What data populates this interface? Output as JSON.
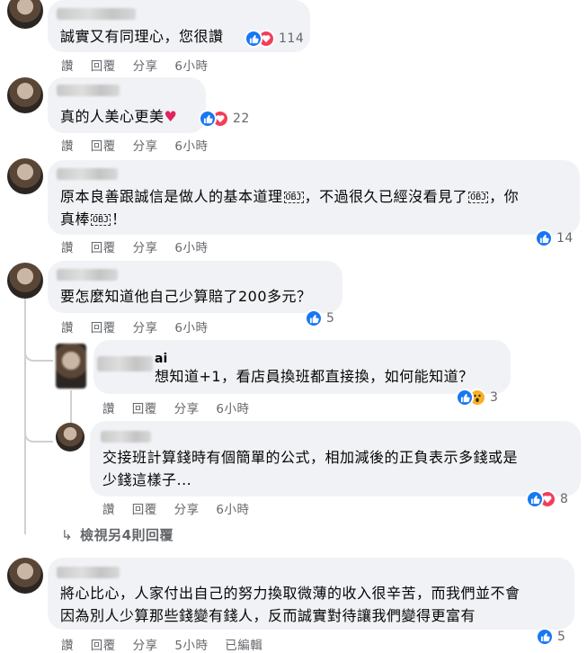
{
  "comments": [
    {
      "text": "誠實又有同理心，您很讚",
      "actions": {
        "like": "讚",
        "reply": "回覆",
        "share": "分享",
        "time": "6小時"
      },
      "reactions": {
        "types": [
          "like",
          "love"
        ],
        "count": "114"
      }
    },
    {
      "text": "真的人美心更美",
      "emoji": "♥",
      "actions": {
        "like": "讚",
        "reply": "回覆",
        "share": "分享",
        "time": "6小時"
      },
      "reactions": {
        "types": [
          "like",
          "love"
        ],
        "count": "22"
      }
    },
    {
      "text_line1_a": "原本良善跟誠信是做人的基本道理",
      "text_line1_b": "，不過很久已經沒看見了",
      "text_line1_c": "，你",
      "text_line2_a": "真棒",
      "text_line2_b": "！",
      "obj_glyph": "OBJ",
      "actions": {
        "like": "讚",
        "reply": "回覆",
        "share": "分享",
        "time": "6小時"
      },
      "reactions": {
        "types": [
          "like"
        ],
        "count": "14"
      }
    },
    {
      "text": "要怎麼知道他自己少算賠了200多元？",
      "actions": {
        "like": "讚",
        "reply": "回覆",
        "share": "分享",
        "time": "6小時"
      },
      "reactions": {
        "types": [
          "like"
        ],
        "count": "5"
      },
      "replies": [
        {
          "name_suffix": "ai",
          "text": "想知道+1，看店員換班都直接換，如何能知道？",
          "actions": {
            "like": "讚",
            "reply": "回覆",
            "share": "分享",
            "time": "6小時"
          },
          "reactions": {
            "types": [
              "like",
              "wow"
            ],
            "count": "3"
          }
        },
        {
          "text_line1": "交接班計算錢時有個簡單的公式，相加減後的正負表示多錢或是",
          "text_line2": "少錢這樣子...",
          "actions": {
            "like": "讚",
            "reply": "回覆",
            "share": "分享",
            "time": "6小時"
          },
          "reactions": {
            "types": [
              "like",
              "love"
            ],
            "count": "8"
          }
        }
      ],
      "more_replies": "檢視另4則回覆"
    },
    {
      "text_line1": "將心比心，人家付出自己的努力換取微薄的收入很辛苦，而我們並不會",
      "text_line2": "因為別人少算那些錢變有錢人，反而誠實對待讓我們變得更富有",
      "actions": {
        "like": "讚",
        "reply": "回覆",
        "share": "分享",
        "time": "5小時",
        "edited": "已編輯"
      },
      "reactions": {
        "types": [
          "like"
        ],
        "count": "5"
      }
    }
  ],
  "colors": {
    "like": "#1877f2",
    "love": "#f33e58",
    "wow": "#f7b125",
    "bubble": "#f0f2f5",
    "meta": "#65676b"
  },
  "icons": {
    "like": "thumbs-up-icon",
    "love": "heart-icon",
    "wow": "wow-face-icon",
    "reply_arrow": "reply-arrow-icon"
  }
}
